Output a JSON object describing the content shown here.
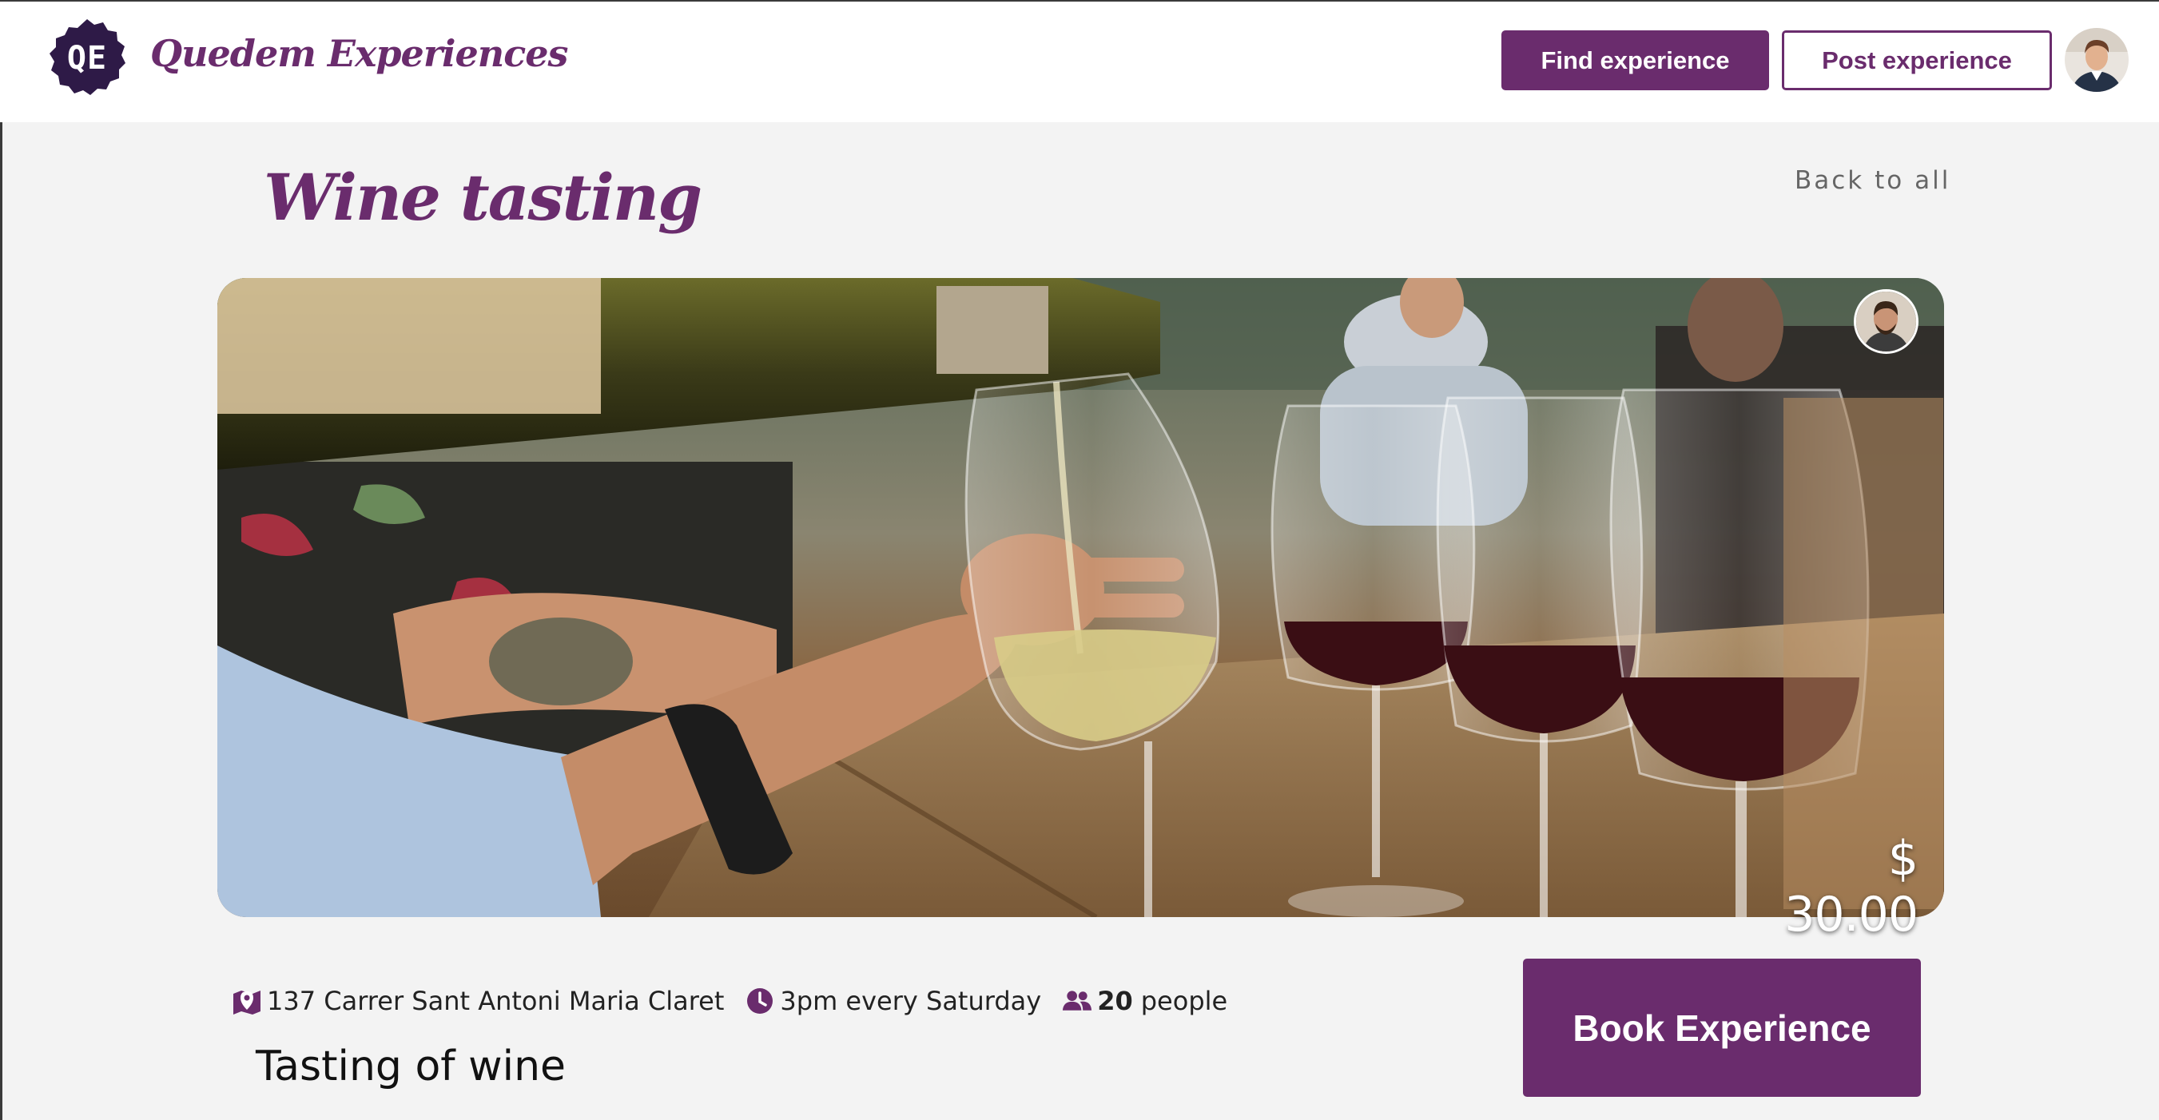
{
  "header": {
    "logo_initials": "QE",
    "brand_name": "Quedem Experiences",
    "find_button": "Find experience",
    "post_button": "Post experience",
    "user_avatar_icon": "user-avatar-icon"
  },
  "experience": {
    "title": "Wine tasting",
    "back_link": "Back to all",
    "price": "$ 30.00",
    "host_avatar_icon": "host-avatar-icon",
    "location_icon": "map-marker-icon",
    "location": "137 Carrer Sant Antoni Maria Claret",
    "time_icon": "clock-icon",
    "schedule": "3pm every Saturday",
    "people_icon": "users-icon",
    "capacity_count": "20",
    "capacity_label": "people",
    "description": "Tasting of wine",
    "book_button": "Book Experience"
  },
  "colors": {
    "brand": "#6a2c6d",
    "logo_badge": "#2e1a47",
    "background": "#f3f3f3"
  }
}
